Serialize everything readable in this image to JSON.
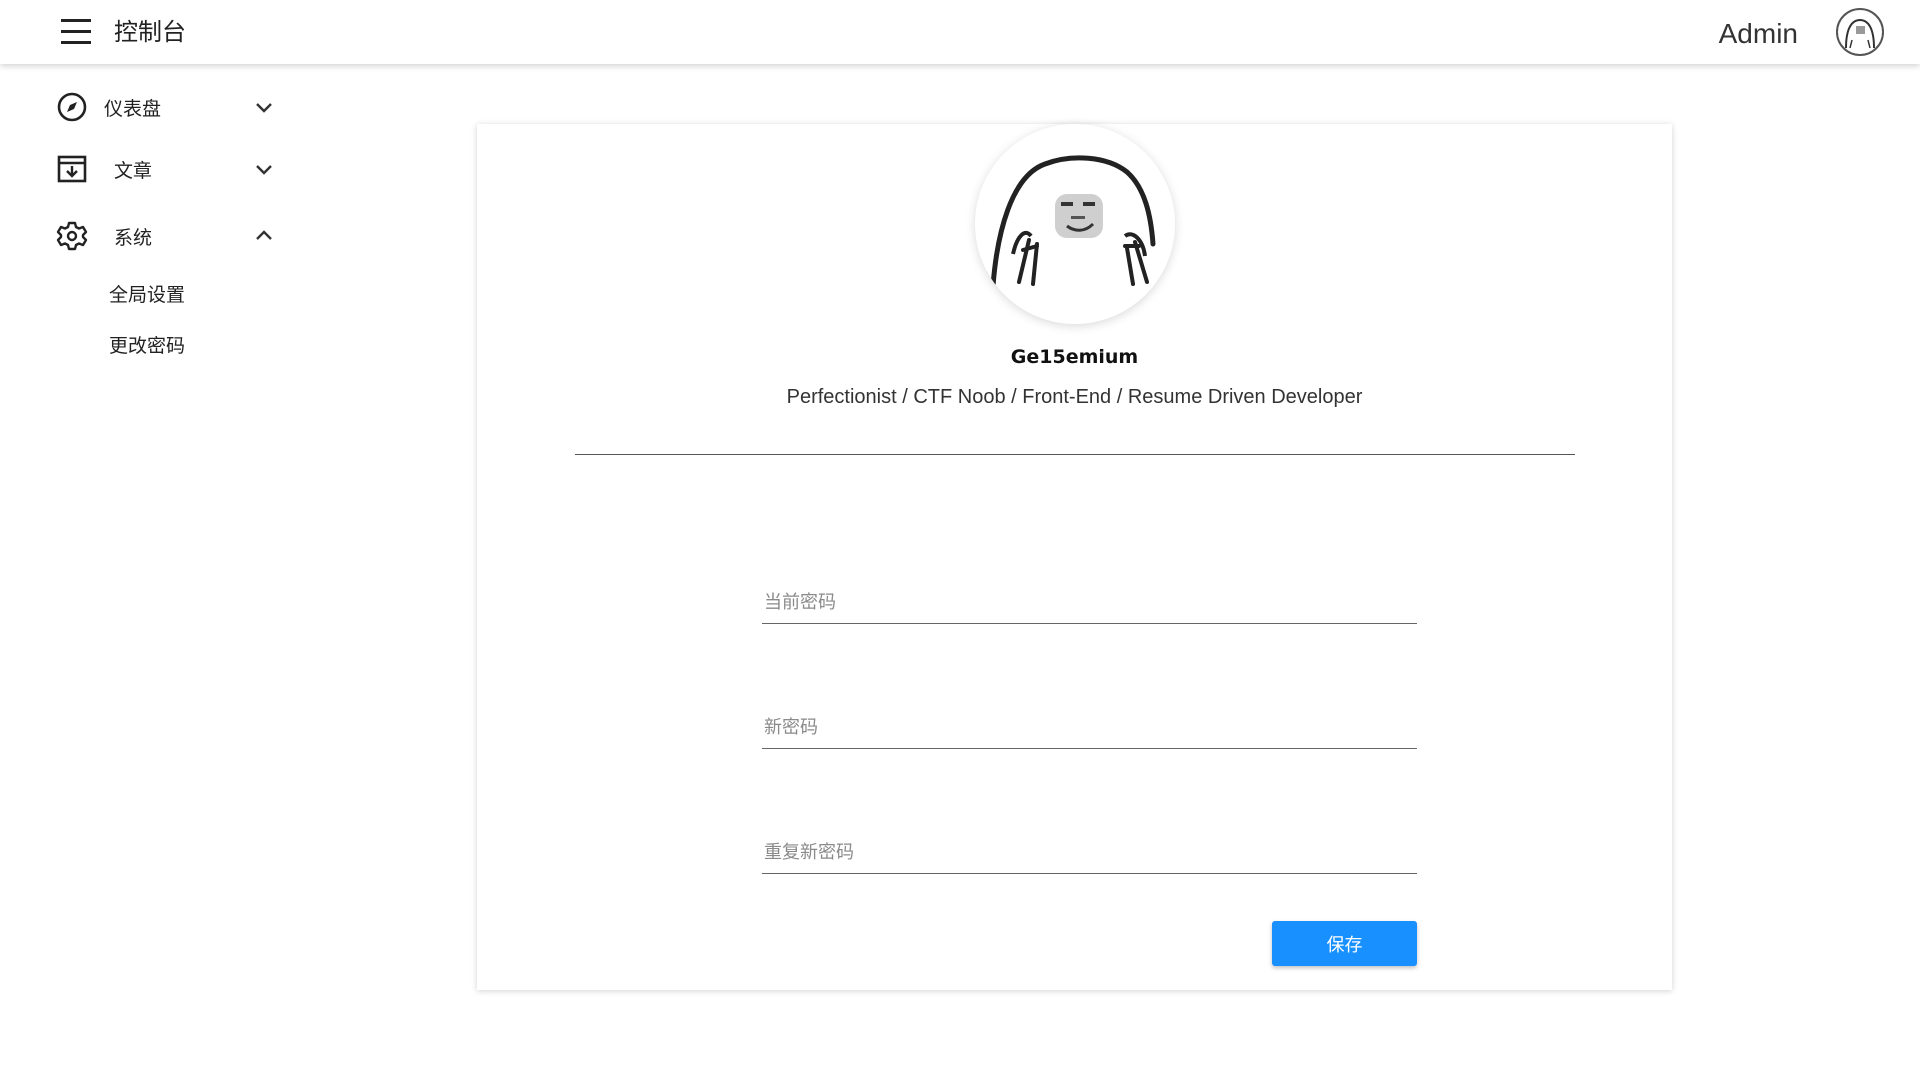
{
  "header": {
    "title": "控制台",
    "user_name": "Admin",
    "menu_icon": "hamburger-menu-icon",
    "avatar_icon": "user-avatar"
  },
  "sidebar": {
    "items": [
      {
        "label": "仪表盘",
        "icon": "compass-icon",
        "expanded": false
      },
      {
        "label": "文章",
        "icon": "archive-icon",
        "expanded": false
      },
      {
        "label": "系统",
        "icon": "gear-icon",
        "expanded": true
      }
    ],
    "sub_items": [
      {
        "label": "全局设置"
      },
      {
        "label": "更改密码"
      }
    ]
  },
  "profile": {
    "name": "Ge15emium",
    "bio": "Perfectionist / CTF Noob / Front-End / Resume Driven Developer"
  },
  "form": {
    "current_password_placeholder": "当前密码",
    "new_password_placeholder": "新密码",
    "repeat_password_placeholder": "重复新密码",
    "current_password_value": "",
    "new_password_value": "",
    "repeat_password_value": "",
    "save_label": "保存"
  },
  "colors": {
    "primary": "#1890ff",
    "text": "#222222",
    "placeholder": "#8a8a8a"
  }
}
